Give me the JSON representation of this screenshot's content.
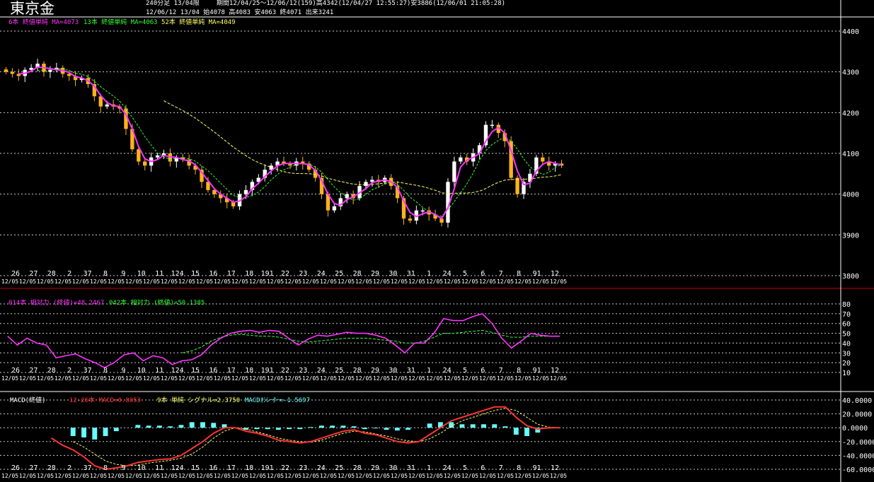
{
  "header": {
    "title": "東京金",
    "info1": "240分足 13/04限",
    "info2": "期間12/04/25～12/06/12(159)高4342(12/04/27 12:55:27)安3886(12/06/01 21:05:28)",
    "info3": "12/06/12 13/04 始4078 高4083 安4063 終4071 出来3241"
  },
  "legends": {
    "price": [
      {
        "text": "6本 終値単純 MA=4073",
        "color": "#ff33ff"
      },
      {
        "text": "13本 終値単純 MA=4063",
        "color": "#33ff33"
      },
      {
        "text": "52本 終値単純 MA=4049",
        "color": "#ffff66"
      }
    ],
    "rsi": [
      {
        "text": "014本 相対力 (終値)=48.2467",
        "color": "#ff33ff"
      },
      {
        "text": "042本 相対力 (終値)=50.1385",
        "color": "#33ff33"
      }
    ],
    "macd": [
      {
        "text": "MACD(終値)",
        "color": "#ffffff"
      },
      {
        "text": "12-26本 MACD=0.8053",
        "color": "#ff3333"
      },
      {
        "text": "9本 単純 シグナル=2.3750",
        "color": "#ffff66"
      },
      {
        "text": "MACDｵｼﾚｰﾀｰ=-1.5697",
        "color": "#66ffff"
      }
    ]
  },
  "x_labels": [
    "26",
    "27",
    "28",
    "2",
    "37",
    "8",
    "9",
    "10",
    "11",
    "124",
    "15",
    "16",
    "17",
    "18",
    "191",
    "22",
    "23",
    "24",
    "25",
    "28",
    "29",
    "30",
    "31",
    "1",
    "24",
    "5",
    "6",
    "7",
    "8",
    "91",
    "12"
  ],
  "x_date_label": "12/05",
  "chart_data": [
    {
      "type": "candlestick",
      "y_ticks": [
        "4400",
        "4300",
        "4200",
        "4100",
        "4000",
        "3900",
        "3800"
      ],
      "ylim": [
        3800,
        4400
      ],
      "up_color": "#ffffff",
      "down_color": "#ffb31a",
      "close": [
        4300,
        4295,
        4290,
        4305,
        4310,
        4320,
        4300,
        4305,
        4310,
        4295,
        4290,
        4280,
        4285,
        4270,
        4240,
        4215,
        4220,
        4215,
        4210,
        4160,
        4110,
        4080,
        4070,
        4090,
        4095,
        4100,
        4080,
        4090,
        4085,
        4070,
        4060,
        4030,
        4010,
        4000,
        3990,
        3980,
        3970,
        4000,
        4010,
        4030,
        4040,
        4060,
        4070,
        4080,
        4075,
        4070,
        4080,
        4075,
        4060,
        4040,
        4000,
        3960,
        3970,
        3990,
        4000,
        3990,
        4020,
        4030,
        4035,
        4030,
        4040,
        4020,
        3990,
        3940,
        3935,
        3960,
        3960,
        3950,
        3940,
        3930,
        4030,
        4080,
        4090,
        4080,
        4100,
        4120,
        4170,
        4170,
        4150,
        4130,
        4040,
        4000,
        4030,
        4050,
        4090,
        4080,
        4070,
        4075,
        4070
      ],
      "annotations": {
        "high": "4342 (12/04/27)",
        "low": "3886 (12/06/01)"
      }
    },
    {
      "type": "line",
      "name": "RSI",
      "y_ticks": [
        "80",
        "70",
        "60",
        "50",
        "40",
        "30",
        "20",
        "10"
      ],
      "ylim": [
        10,
        80
      ],
      "series": [
        {
          "name": "014本 相対力",
          "color": "#ff33ff",
          "values": [
            47,
            38,
            45,
            40,
            38,
            25,
            27,
            29,
            24,
            20,
            15,
            20,
            28,
            30,
            22,
            27,
            25,
            18,
            22,
            23,
            28,
            38,
            45,
            50,
            52,
            53,
            51,
            53,
            52,
            45,
            38,
            44,
            48,
            47,
            49,
            51,
            50,
            50,
            48,
            45,
            38,
            30,
            40,
            40,
            50,
            65,
            63,
            63,
            67,
            70,
            60,
            45,
            35,
            42,
            50,
            48,
            47,
            47
          ]
        },
        {
          "name": "042本 相対力",
          "color": "#33ff33",
          "values": [
            null,
            null,
            null,
            null,
            null,
            null,
            null,
            null,
            null,
            null,
            null,
            null,
            null,
            null,
            null,
            null,
            null,
            null,
            30,
            32,
            36,
            42,
            46,
            48,
            49,
            48,
            47,
            47,
            46,
            44,
            42,
            41,
            42,
            43,
            44,
            45,
            45,
            45,
            44,
            43,
            42,
            40,
            40,
            42,
            46,
            50,
            50,
            51,
            52,
            53,
            51,
            48,
            46,
            46,
            47,
            47,
            47,
            47
          ]
        }
      ]
    },
    {
      "type": "bar+line",
      "name": "MACD",
      "y_ticks": [
        "40.0000",
        "20.0000",
        "0.0000",
        "-20.0000",
        "-40.0000",
        "-60.0000"
      ],
      "ylim": [
        -60,
        40
      ],
      "series": [
        {
          "name": "MACD",
          "color": "#ff3333",
          "values": [
            null,
            null,
            null,
            null,
            -15,
            -25,
            -32,
            -42,
            -55,
            -60,
            -58,
            -55,
            -50,
            -48,
            -46,
            -45,
            -40,
            -30,
            -20,
            -8,
            0,
            0,
            -5,
            -8,
            -12,
            -18,
            -20,
            -22,
            -20,
            -15,
            -10,
            -5,
            -3,
            -8,
            -10,
            -15,
            -20,
            -22,
            -20,
            -10,
            0,
            10,
            15,
            20,
            25,
            30,
            30,
            15,
            3,
            -2,
            0,
            0
          ]
        },
        {
          "name": "シグナル",
          "color": "#ffff66",
          "values": [
            null,
            null,
            null,
            null,
            null,
            null,
            -20,
            -28,
            -38,
            -48,
            -53,
            -55,
            -54,
            -51,
            -49,
            -47,
            -44,
            -38,
            -28,
            -15,
            -5,
            0,
            -2,
            -6,
            -10,
            -15,
            -18,
            -20,
            -21,
            -18,
            -13,
            -8,
            -5,
            -6,
            -9,
            -12,
            -16,
            -19,
            -20,
            -16,
            -8,
            2,
            10,
            15,
            20,
            25,
            28,
            25,
            15,
            5,
            1,
            0
          ]
        },
        {
          "name": "MACDｵｼﾚｰﾀｰ",
          "color": "#66ffff",
          "values": [
            0,
            0,
            0,
            0,
            0,
            0,
            -12,
            -14,
            -17,
            -12,
            -5,
            0,
            4,
            3,
            3,
            2,
            4,
            8,
            8,
            7,
            5,
            0,
            -3,
            -2,
            -2,
            -3,
            -2,
            -2,
            1,
            3,
            3,
            3,
            2,
            -2,
            -1,
            -3,
            -4,
            -3,
            0,
            6,
            8,
            8,
            5,
            5,
            5,
            5,
            2,
            -10,
            -12,
            -7,
            -1,
            0
          ]
        }
      ]
    }
  ]
}
